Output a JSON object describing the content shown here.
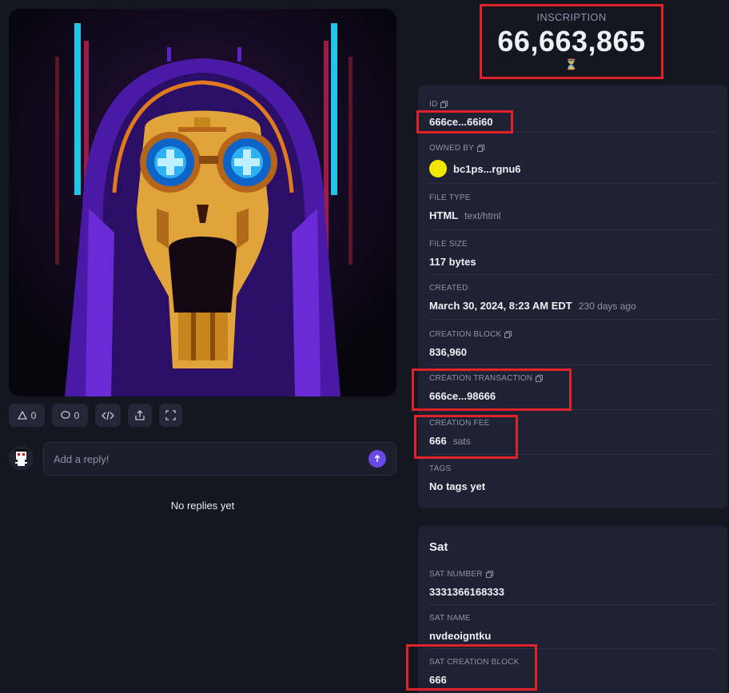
{
  "inscription": {
    "label": "INSCRIPTION",
    "number": "66,663,865",
    "pending_icon": "hourglass-icon"
  },
  "actions": {
    "upvote_count": "0",
    "comment_count": "0"
  },
  "reply": {
    "placeholder": "Add a reply!",
    "empty_text": "No replies yet"
  },
  "details": {
    "id": {
      "label": "ID",
      "value": "666ce...66i60"
    },
    "owner": {
      "label": "OWNED BY",
      "value": "bc1ps...rgnu6",
      "avatar_color": "#f3e600"
    },
    "file_type": {
      "label": "FILE TYPE",
      "value": "HTML",
      "mime": "text/html"
    },
    "file_size": {
      "label": "FILE SIZE",
      "value": "117 bytes"
    },
    "created": {
      "label": "CREATED",
      "value": "March 30, 2024, 8:23 AM EDT",
      "relative": "230 days ago"
    },
    "creation_block": {
      "label": "CREATION BLOCK",
      "value": "836,960"
    },
    "creation_tx": {
      "label": "CREATION TRANSACTION",
      "value": "666ce...98666"
    },
    "creation_fee": {
      "label": "CREATION FEE",
      "value": "666",
      "unit": "sats"
    },
    "tags": {
      "label": "TAGS",
      "value": "No tags yet"
    }
  },
  "sat": {
    "title": "Sat",
    "number": {
      "label": "SAT NUMBER",
      "value": "3331366168333"
    },
    "name": {
      "label": "SAT NAME",
      "value": "nvdeoigntku"
    },
    "creation_block": {
      "label": "SAT CREATION BLOCK",
      "value": "666"
    }
  },
  "colors": {
    "background": "#141620",
    "panel": "#1f2233",
    "accent": "#6a48e8",
    "highlight": "#e1222b"
  }
}
